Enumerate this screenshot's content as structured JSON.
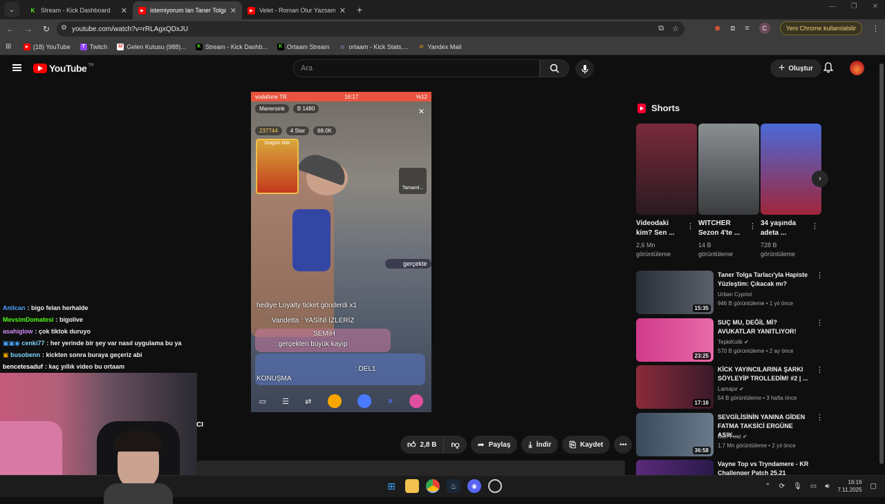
{
  "browser": {
    "tabs": [
      {
        "title": "Stream - Kick Dashboard",
        "fav": "K",
        "fav_color": "#53fc18",
        "active": false
      },
      {
        "title": "istemiyorum lan Taner Tolga Tar",
        "fav": "▶",
        "fav_color": "#ff0000",
        "active": true
      },
      {
        "title": "Velet - Roman Olur Yazsam Sen",
        "fav": "▶",
        "fav_color": "#ff0000",
        "active": false
      }
    ],
    "url": "youtube.com/watch?v=rRLAgxQDxJU",
    "profile_initial": "C",
    "update_label": "Yeni Chrome kullanılabilir",
    "bookmarks": [
      {
        "label": "(18) YouTube",
        "ic": "▶",
        "color": "#ff0000"
      },
      {
        "label": "Twitch",
        "ic": "T",
        "color": "#9146ff"
      },
      {
        "label": "Gelen Kutusu (988)...",
        "ic": "M",
        "color": "#ea4335"
      },
      {
        "label": "Stream - Kick Dashb...",
        "ic": "K",
        "color": "#53fc18"
      },
      {
        "label": "Ortaam Stream",
        "ic": "K",
        "color": "#53fc18"
      },
      {
        "label": "ortaam - Kick Stats,...",
        "ic": "◎",
        "color": "#8aa0ff"
      },
      {
        "label": "Yandex Mail",
        "ic": "✉",
        "color": "#f7a600"
      }
    ]
  },
  "youtube": {
    "logo_text": "YouTube",
    "logo_region": "TR",
    "search_placeholder": "Ara",
    "create_label": "Oluştur"
  },
  "video": {
    "status_left": "vodafone TR",
    "status_time": "16:17",
    "status_right": "%12",
    "top_user": "Manersink",
    "top_sub": "B 1480",
    "coins": "237744",
    "stars": "4 Star",
    "fans": "68.0K",
    "dragon_label": "Dragon War",
    "side_badge": "Tamaml...",
    "overlay_user": "gerçekte",
    "chat": [
      {
        "text": "hediye Loyalty ticket gönderdi  x1"
      },
      {
        "text": "Vandetta : YASİNİ İZLERİZ"
      },
      {
        "text": "SEMİH"
      },
      {
        "text": ": gerçekten büyük kayıp"
      },
      {
        "text": ": DEL1"
      },
      {
        "text": "KONUŞMA"
      }
    ]
  },
  "stream_chat": [
    {
      "user": "Anilcan",
      "color": "#4aa3ff",
      "msg": ": bigo felan herhalde"
    },
    {
      "user": "MevsimDomatesi",
      "color": "#53fc18",
      "msg": ": bigolive"
    },
    {
      "user": "asahiglow",
      "color": "#d58cff",
      "msg": ": çok tiktok duruyo"
    },
    {
      "user": "cenki77",
      "color": "#7fd6ff",
      "msg": ": her yerinde bir şey var nasıl uygulama bu ya"
    },
    {
      "user": "busobenn",
      "color": "#7fd6ff",
      "msg": ": kickten sonra buraya geçeriz abi"
    },
    {
      "user": "bencetesaduf",
      "color": "#ffffff",
      "msg": ": kaç yıllık video bu ortaam"
    }
  ],
  "cropped_text": "CI",
  "actions": {
    "likes": "2,8 B",
    "share": "Paylaş",
    "download": "İndir",
    "save": "Kaydet"
  },
  "shorts": {
    "title": "Shorts",
    "items": [
      {
        "title": "Videodaki kim? Sen ...",
        "views": "2,6 Mn görüntüleme",
        "color": "#5a2a3a"
      },
      {
        "title": "WITCHER Sezon 4'te ...",
        "views": "14 B görüntüleme",
        "color": "#6a6f72"
      },
      {
        "title": "34 yaşında adeta ...",
        "views": "728 B görüntüleme",
        "color": "#2b4aa8"
      }
    ]
  },
  "recommendations": [
    {
      "title": "Taner Tolga Tarlacı'yla Hapiste Yüzleştim: Çıkacak mı?",
      "channel": "Urban Cypriot",
      "meta": "946 B görüntüleme • 1 yıl önce",
      "duration": "15:35",
      "color": "#3a3f48",
      "verified": false
    },
    {
      "title": "SUÇ MU, DEĞİL Mİ? AVUKATLAR YANITLIYOR!",
      "channel": "TepkiKolik",
      "meta": "570 B görüntüleme • 2 ay önce",
      "duration": "23:25",
      "color": "#c23a7a",
      "verified": true
    },
    {
      "title": "KİCK YAYINCILARINA ŞARKI SÖYLEYİP TROLLEDİM! #2 | ...",
      "channel": "Lamajor",
      "meta": "54 B görüntüleme • 3 hafta önce",
      "duration": "17:16",
      "color": "#7a2a3a",
      "verified": true
    },
    {
      "title": "SEVGİLİSİNİN YANINA GİDEN FATMA TAKSİCİ ERGÜNE ASIK...",
      "channel": "İlker Fırat",
      "meta": "1,7 Mn görüntüleme • 2 yıl önce",
      "duration": "36:58",
      "color": "#3a4a5a",
      "verified": true
    },
    {
      "title": "Vayne Top vs Tryndamere - KR Challenger Patch 25.21",
      "channel": "",
      "meta": "",
      "duration": "",
      "color": "#4a2a6a",
      "verified": false
    }
  ],
  "taskbar": {
    "time": "16:16",
    "date": "7.11.2025"
  }
}
